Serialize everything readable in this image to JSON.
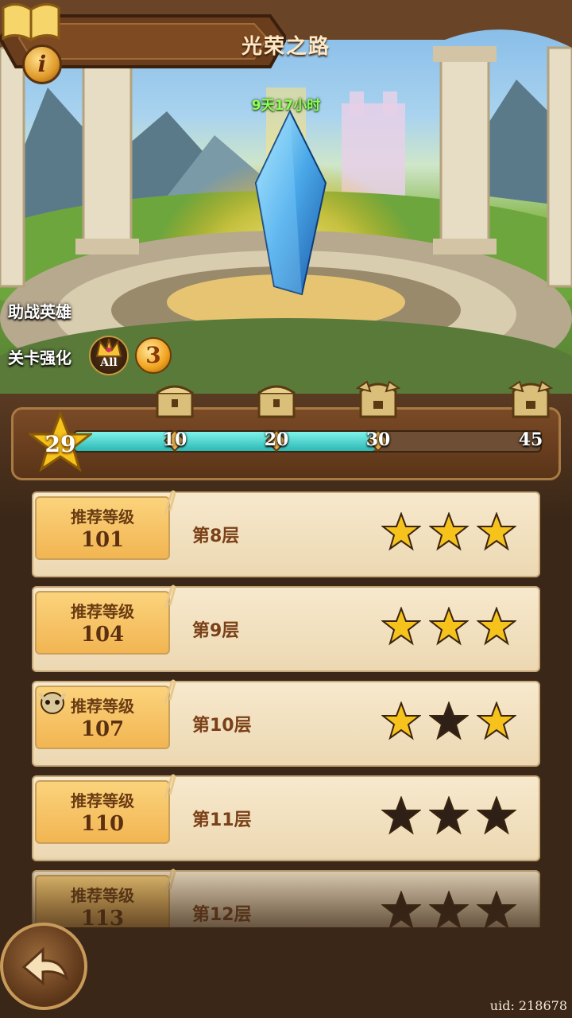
{
  "header": {
    "title": "光荣之路",
    "timer": "9天17小时"
  },
  "side": {
    "assist_heroes_label": "助战英雄",
    "stage_boost_label": "关卡强化",
    "crown_badge": "All",
    "boost_count": "3"
  },
  "progress": {
    "current_stars": "29",
    "max": 45,
    "fill_value": 29,
    "milestones": [
      {
        "value": "10",
        "reward": "chest-icon"
      },
      {
        "value": "20",
        "reward": "chest-icon"
      },
      {
        "value": "30",
        "reward": "ornate-chest-icon"
      },
      {
        "value": "45",
        "reward": "ornate-chest-icon"
      }
    ]
  },
  "stages": [
    {
      "label": "推荐等级",
      "level": "101",
      "floor": "第8层",
      "stars": [
        true,
        true,
        true
      ],
      "boss": false
    },
    {
      "label": "推荐等级",
      "level": "104",
      "floor": "第9层",
      "stars": [
        true,
        true,
        true
      ],
      "boss": false
    },
    {
      "label": "推荐等级",
      "level": "107",
      "floor": "第10层",
      "stars": [
        true,
        false,
        true
      ],
      "boss": true
    },
    {
      "label": "推荐等级",
      "level": "110",
      "floor": "第11层",
      "stars": [
        false,
        false,
        false
      ],
      "boss": false
    },
    {
      "label": "推荐等级",
      "level": "113",
      "floor": "第12层",
      "stars": [
        false,
        false,
        false
      ],
      "boss": false
    }
  ],
  "footer": {
    "uid": "uid: 218678"
  },
  "colors": {
    "star_gold": "#f6c21c",
    "star_empty": "#2e2016",
    "bar_fill": "#2cb8b4",
    "timer": "#8dff5a"
  }
}
